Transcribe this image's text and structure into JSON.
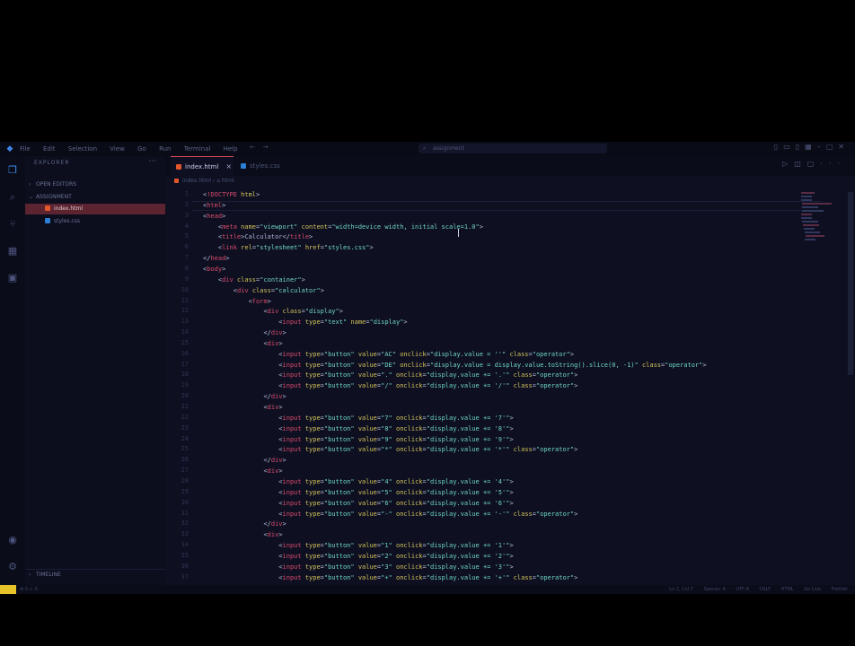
{
  "titlebar": {
    "menu": [
      "File",
      "Edit",
      "Selection",
      "View",
      "Go",
      "Run",
      "Terminal",
      "Help"
    ],
    "search_placeholder": "assignment",
    "logo_icon": "vscode-logo-icon",
    "nav_back": "←",
    "nav_forward": "→"
  },
  "activity_icons": [
    "files-icon",
    "search-icon",
    "source-control-icon",
    "extensions-icon",
    "remote-icon",
    "account-icon",
    "settings-gear-icon"
  ],
  "sidebar": {
    "title": "EXPLORER",
    "open_editors": "OPEN EDITORS",
    "folder": "ASSIGNMENT",
    "files": [
      {
        "name": "index.html",
        "type": "html",
        "selected": true
      },
      {
        "name": "styles.css",
        "type": "css",
        "selected": false
      }
    ],
    "timeline": "TIMELINE"
  },
  "tabs": [
    {
      "label": "index.html",
      "type": "html",
      "active": true,
      "close": "×"
    },
    {
      "label": "styles.css",
      "type": "css",
      "active": false
    }
  ],
  "breadcrumb": [
    "index.html",
    "html"
  ],
  "code_lines": [
    {
      "n": "1",
      "text": "<!DOCTYPE html>"
    },
    {
      "n": "2",
      "text": "<html>"
    },
    {
      "n": "3",
      "text": "<head>"
    },
    {
      "n": "4",
      "text": "    <meta name=\"viewport\" content=\"width=device width, initial scale=1.0\">"
    },
    {
      "n": "5",
      "text": "    <title>Calculator</title>"
    },
    {
      "n": "6",
      "text": "    <link rel=\"stylesheet\" href=\"styles.css\">"
    },
    {
      "n": "7",
      "text": "</head>"
    },
    {
      "n": "8",
      "text": "<body>"
    },
    {
      "n": "9",
      "text": "    <div class=\"container\">"
    },
    {
      "n": "10",
      "text": "        <div class=\"calculator\">"
    },
    {
      "n": "11",
      "text": "            <form>"
    },
    {
      "n": "12",
      "text": "                <div class=\"display\">"
    },
    {
      "n": "13",
      "text": "                    <input type=\"text\" name=\"display\">"
    },
    {
      "n": "14",
      "text": "                </div>"
    },
    {
      "n": "15",
      "text": "                <div>"
    },
    {
      "n": "16",
      "text": "                    <input type=\"button\" value=\"AC\" onclick=\"display.value = ''\" class=\"operator\">"
    },
    {
      "n": "17",
      "text": "                    <input type=\"button\" value=\"DE\" onclick=\"display.value = display.value.toString().slice(0, -1)\" class=\"operator\">"
    },
    {
      "n": "18",
      "text": "                    <input type=\"button\" value=\".\" onclick=\"display.value += '.'\" class=\"operator\">"
    },
    {
      "n": "19",
      "text": "                    <input type=\"button\" value=\"/\" onclick=\"display.value += '/'\" class=\"operator\">"
    },
    {
      "n": "20",
      "text": "                </div>"
    },
    {
      "n": "21",
      "text": "                <div>"
    },
    {
      "n": "22",
      "text": "                    <input type=\"button\" value=\"7\" onclick=\"display.value += '7'\">"
    },
    {
      "n": "23",
      "text": "                    <input type=\"button\" value=\"8\" onclick=\"display.value += '8'\">"
    },
    {
      "n": "24",
      "text": "                    <input type=\"button\" value=\"9\" onclick=\"display.value += '9'\">"
    },
    {
      "n": "25",
      "text": "                    <input type=\"button\" value=\"*\" onclick=\"display.value += '*'\" class=\"operator\">"
    },
    {
      "n": "26",
      "text": "                </div>"
    },
    {
      "n": "27",
      "text": "                <div>"
    },
    {
      "n": "28",
      "text": "                    <input type=\"button\" value=\"4\" onclick=\"display.value += '4'\">"
    },
    {
      "n": "29",
      "text": "                    <input type=\"button\" value=\"5\" onclick=\"display.value += '5'\">"
    },
    {
      "n": "30",
      "text": "                    <input type=\"button\" value=\"6\" onclick=\"display.value += '6'\">"
    },
    {
      "n": "31",
      "text": "                    <input type=\"button\" value=\"-\" onclick=\"display.value += '-'\" class=\"operator\">"
    },
    {
      "n": "32",
      "text": "                </div>"
    },
    {
      "n": "33",
      "text": "                <div>"
    },
    {
      "n": "34",
      "text": "                    <input type=\"button\" value=\"1\" onclick=\"display.value += '1'\">"
    },
    {
      "n": "35",
      "text": "                    <input type=\"button\" value=\"2\" onclick=\"display.value += '2'\">"
    },
    {
      "n": "36",
      "text": "                    <input type=\"button\" value=\"3\" onclick=\"display.value += '3'\">"
    },
    {
      "n": "37",
      "text": "                    <input type=\"button\" value=\"+\" onclick=\"display.value += '+'\" class=\"operator\">"
    }
  ],
  "active_line": "2",
  "statusbar": {
    "left": "⊗ 0 ⚠ 0",
    "right": [
      "Ln 2, Col 7",
      "Spaces: 4",
      "UTF-8",
      "CRLF",
      "HTML",
      "Go Live",
      "Prettier"
    ]
  },
  "colors": {
    "tag": "#d94a6a",
    "attr": "#d2c25a",
    "value": "#6fd4c6",
    "selected_file_bg": "#5b2430",
    "status_accent": "#e6c329"
  }
}
